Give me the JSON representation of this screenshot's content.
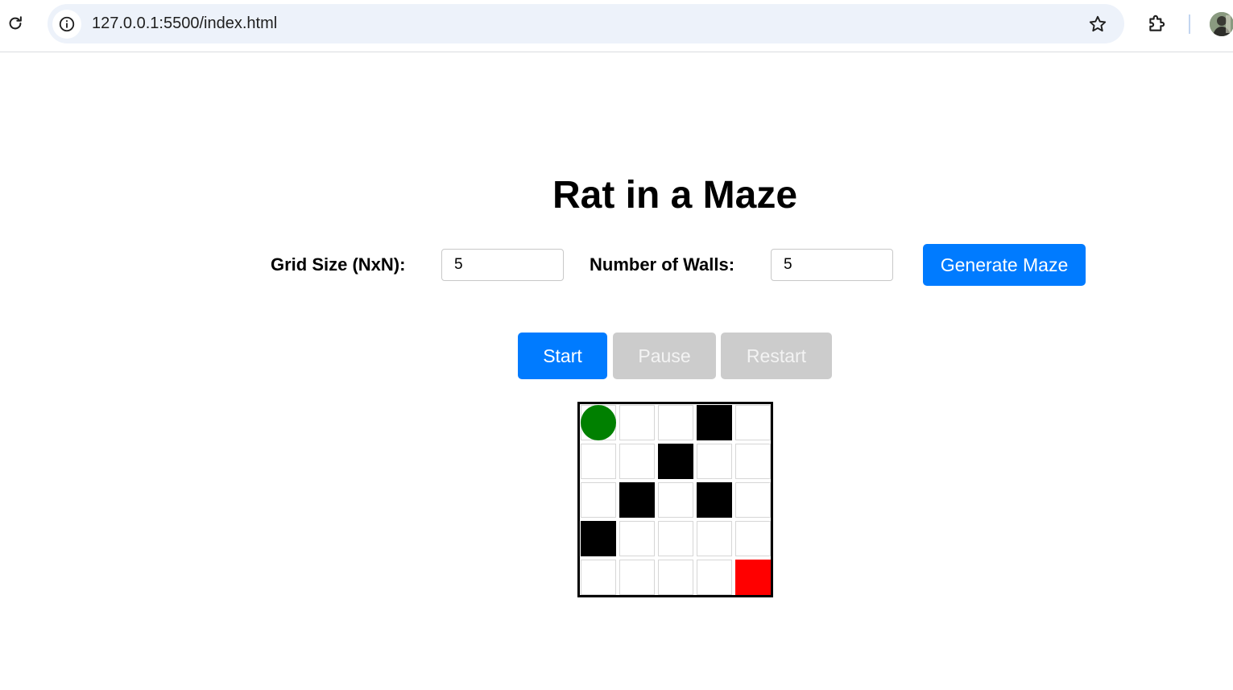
{
  "browser": {
    "url": "127.0.0.1:5500/index.html"
  },
  "page": {
    "title": "Rat in a Maze",
    "grid_size_label": "Grid Size (NxN):",
    "grid_size_value": "5",
    "walls_label": "Number of Walls:",
    "walls_value": "5",
    "generate_label": "Generate Maze",
    "start_label": "Start",
    "pause_label": "Pause",
    "restart_label": "Restart"
  },
  "maze": {
    "size": 5,
    "rat": [
      0,
      0
    ],
    "goal": [
      4,
      4
    ],
    "walls": [
      [
        0,
        3
      ],
      [
        1,
        2
      ],
      [
        2,
        1
      ],
      [
        2,
        3
      ],
      [
        3,
        0
      ]
    ],
    "colors": {
      "wall": "#000000",
      "rat": "#008000",
      "goal": "#ff0000",
      "accent": "#007bff",
      "disabled": "#cccccc"
    }
  }
}
